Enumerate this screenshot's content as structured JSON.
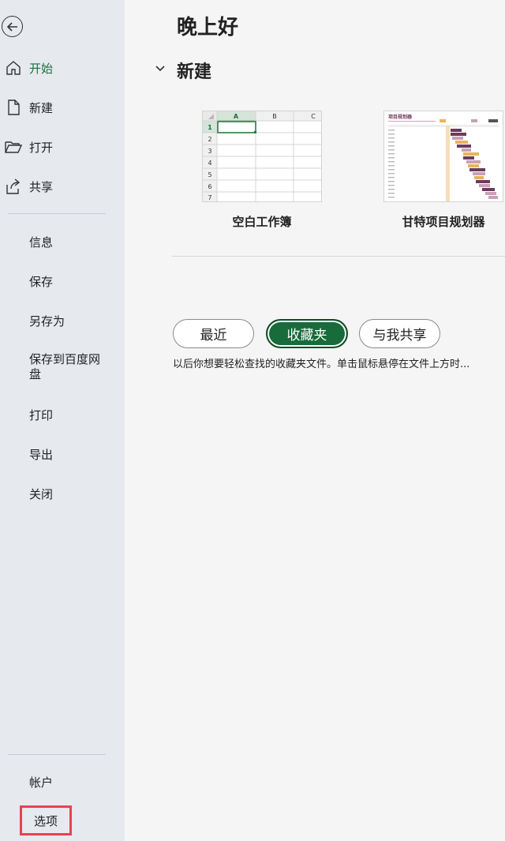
{
  "sidebar": {
    "back_label": "",
    "items": [
      {
        "label": "开始",
        "icon": "home-icon",
        "active": true
      },
      {
        "label": "新建",
        "icon": "new-document-icon"
      },
      {
        "label": "打开",
        "icon": "folder-open-icon"
      },
      {
        "label": "共享",
        "icon": "share-icon"
      }
    ],
    "file_items": [
      "信息",
      "保存",
      "另存为",
      "保存到百度网盘",
      "打印",
      "导出",
      "关闭"
    ],
    "bottom_items": [
      "帐户",
      "选项"
    ]
  },
  "main": {
    "greeting": "晚上好",
    "new_section": {
      "title": "新建",
      "templates": [
        {
          "name": "空白工作簿"
        },
        {
          "name": "甘特项目规划器",
          "thumb_title": "项目规划器"
        }
      ]
    },
    "blank_grid": {
      "columns": [
        "A",
        "B",
        "C"
      ],
      "rows": [
        "1",
        "2",
        "3",
        "4",
        "5",
        "6",
        "7"
      ]
    },
    "tabs": [
      "最近",
      "收藏夹",
      "与我共享"
    ],
    "active_tab": "收藏夹",
    "hint": "以后你想要轻松查找的收藏夹文件。单击鼠标悬停在文件上方时..."
  },
  "colors": {
    "accent": "#186b3a",
    "sidebar_bg": "#e6e9ee",
    "highlight_box": "#e6434f"
  }
}
